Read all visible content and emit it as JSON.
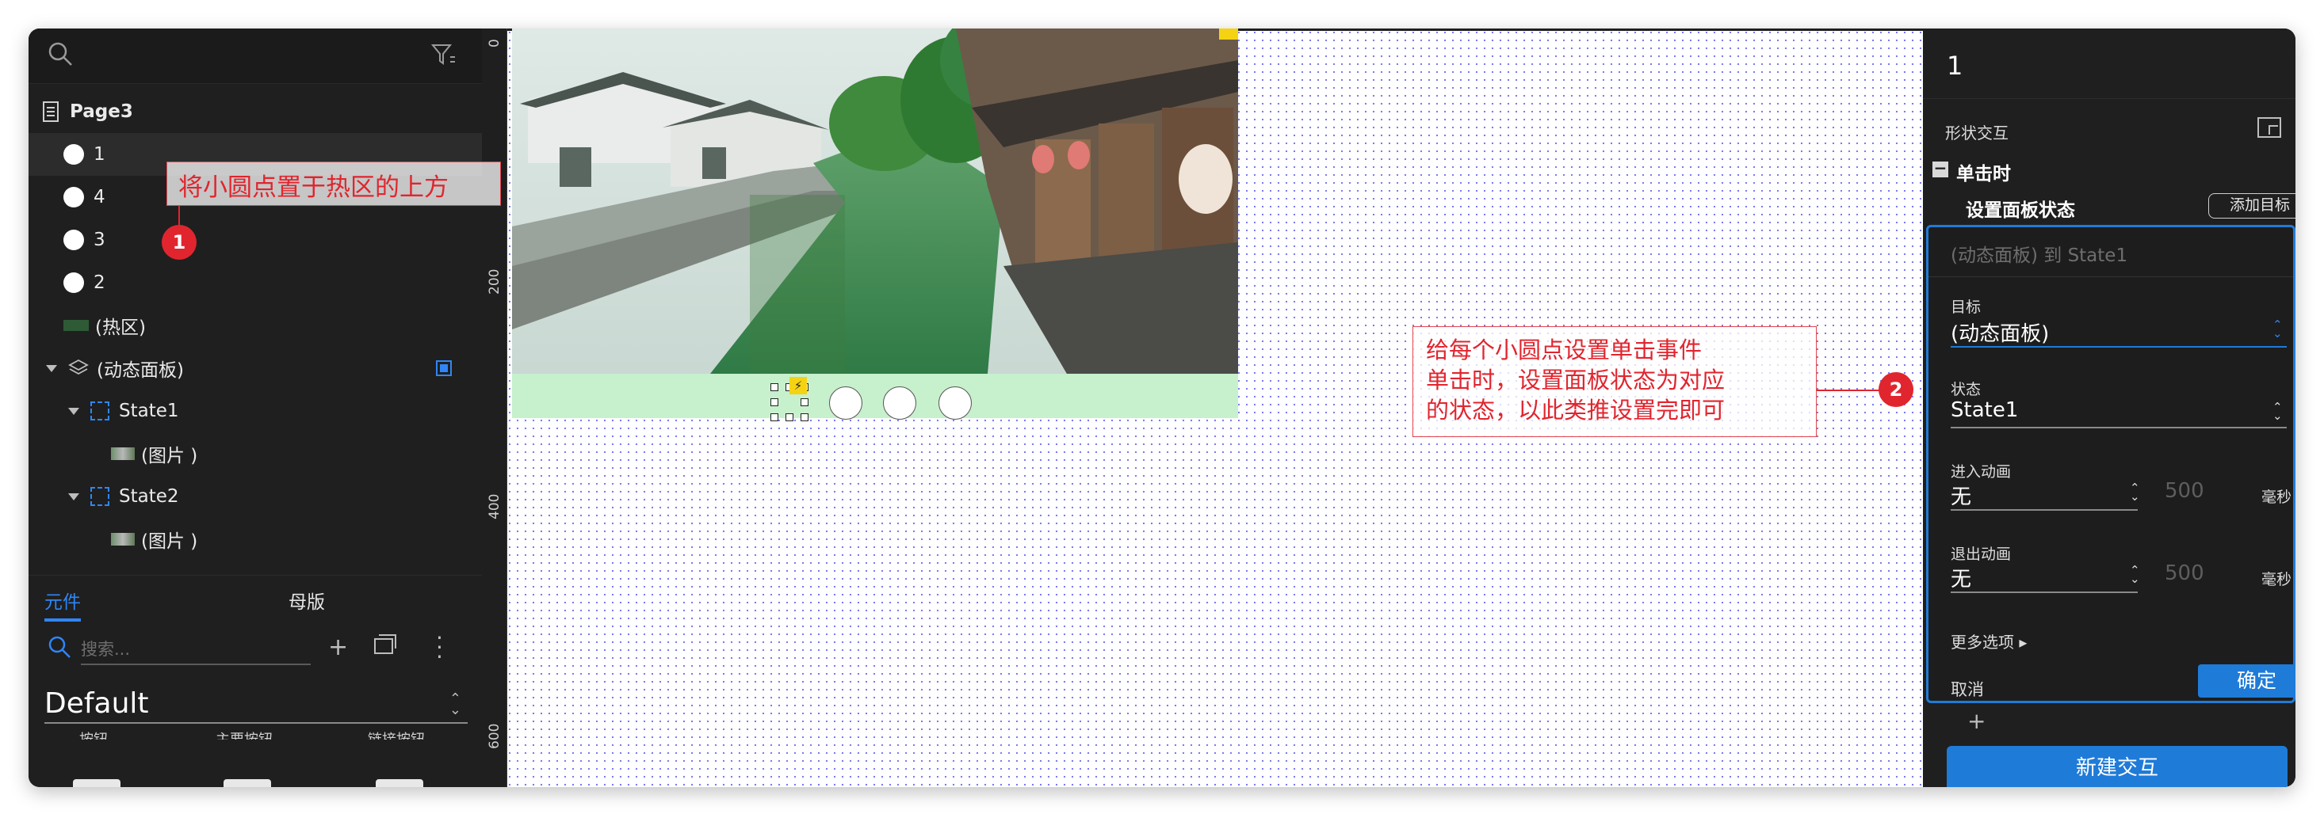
{
  "left_panel": {
    "layers": {
      "page": "Page3",
      "items": [
        {
          "label": "1"
        },
        {
          "label": "4"
        },
        {
          "label": "3"
        },
        {
          "label": "2"
        },
        {
          "label": "(热区)"
        },
        {
          "label": "(动态面板)"
        },
        {
          "label": "State1"
        },
        {
          "label": "(图片 )"
        },
        {
          "label": "State2"
        },
        {
          "label": "(图片 )"
        }
      ]
    },
    "tabs": [
      "元件",
      "母版"
    ],
    "library": {
      "search_placeholder": "搜索...",
      "selected": "Default",
      "items": [
        "按钮",
        "主要按钮",
        "链接按钮"
      ]
    }
  },
  "canvas": {
    "ruler_ticks": [
      "0",
      "200",
      "400",
      "600"
    ],
    "annotations": [
      {
        "number": "1",
        "text": "将小圆点置于热区的上方"
      },
      {
        "number": "2",
        "lines": [
          "给每个小圆点设置单击事件",
          "单击时，设置面板状态为对应",
          "的状态，以此类推设置完即可"
        ]
      }
    ]
  },
  "right_panel": {
    "title": "1",
    "section": "形状交互",
    "event": "单击时",
    "action": "设置面板状态",
    "add_target": "添加目标",
    "summary": "(动态面板) 到 State1",
    "target_label": "目标",
    "target_value": "(动态面板)",
    "state_label": "状态",
    "state_value": "State1",
    "enter_anim_label": "进入动画",
    "enter_anim_value": "无",
    "enter_duration": "500",
    "exit_anim_label": "退出动画",
    "exit_anim_value": "无",
    "exit_duration": "500",
    "unit": "毫秒",
    "more_options": "更多选项 ▸",
    "cancel": "取消",
    "confirm": "确定",
    "new_interaction": "新建交互",
    "colors": {
      "accent": "#1f7bd8",
      "annotation": "#e1252e",
      "hotzone": "#c7f0cc"
    }
  }
}
